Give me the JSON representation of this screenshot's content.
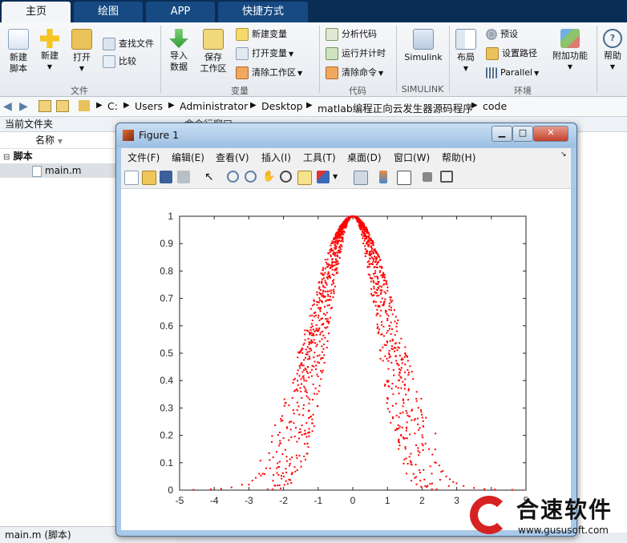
{
  "tabs": [
    "主页",
    "绘图",
    "APP",
    "快捷方式"
  ],
  "ribbon": {
    "file": {
      "new_script": "新建\n脚本",
      "new": "新建",
      "open": "打开",
      "find_files": "查找文件",
      "compare": "比较",
      "group": "文件"
    },
    "variable": {
      "import": "导入\n数据",
      "save_ws": "保存\n工作区",
      "new_var": "新建变量",
      "open_var": "打开变量",
      "clear_ws": "清除工作区",
      "group": "变量"
    },
    "code": {
      "analyze": "分析代码",
      "run_time": "运行并计时",
      "clear_cmd": "清除命令",
      "group": "代码"
    },
    "simulink": {
      "label": "Simulink",
      "group": "SIMULINK"
    },
    "env": {
      "layout": "布局",
      "prefs": "预设",
      "set_path": "设置路径",
      "parallel": "Parallel",
      "addons": "附加功能",
      "group": "环境"
    },
    "help": "帮助",
    "colors": {
      "accent_blue": "#0a2d56",
      "tab_blue": "#174a82"
    }
  },
  "address": {
    "crumbs": [
      "C:",
      "Users",
      "Administrator",
      "Desktop",
      "matlab编程正向云发生器源码程序",
      "code"
    ]
  },
  "left_panel": {
    "title": "当前文件夹",
    "col_name": "名称",
    "group": "脚本",
    "file": "main.m"
  },
  "status": {
    "file": "main.m",
    "type": "(脚本)"
  },
  "cmd_window": {
    "title": "命令行窗口"
  },
  "figure": {
    "title": "Figure 1",
    "menu": [
      "文件(F)",
      "编辑(E)",
      "查看(V)",
      "插入(I)",
      "工具(T)",
      "桌面(D)",
      "窗口(W)",
      "帮助(H)"
    ],
    "toolbar_icons": [
      "new-figure-icon",
      "open-icon",
      "save-icon",
      "print-icon",
      "pointer-icon",
      "zoom-in-icon",
      "zoom-out-icon",
      "pan-icon",
      "rotate-icon",
      "data-cursor-icon",
      "brush-icon",
      "link-icon",
      "colorbar-icon",
      "legend-icon",
      "hide-tools-icon",
      "show-tools-icon"
    ]
  },
  "chart_data": {
    "type": "scatter",
    "title": "",
    "xlabel": "",
    "ylabel": "",
    "xlim": [
      -5,
      5
    ],
    "ylim": [
      0,
      1
    ],
    "xticks": [
      -5,
      -4,
      -3,
      -2,
      -1,
      0,
      1,
      2,
      3,
      4,
      5
    ],
    "yticks": [
      0,
      0.1,
      0.2,
      0.3,
      0.4,
      0.5,
      0.6,
      0.7,
      0.8,
      0.9,
      1
    ],
    "grid": false,
    "marker_color": "#ff0000",
    "series": [
      {
        "values_description_only": "cloud drops",
        "points": [
          [
            0,
            1
          ],
          [
            0.05,
            0.998
          ],
          [
            -0.05,
            0.997
          ],
          [
            0.1,
            0.99
          ],
          [
            -0.1,
            0.99
          ],
          [
            0.15,
            0.985
          ],
          [
            -0.15,
            0.98
          ],
          [
            0.2,
            0.975
          ],
          [
            -0.2,
            0.97
          ],
          [
            0.25,
            0.96
          ],
          [
            -0.25,
            0.96
          ],
          [
            0.3,
            0.95
          ],
          [
            -0.3,
            0.94
          ],
          [
            0.35,
            0.93
          ],
          [
            -0.35,
            0.93
          ],
          [
            0.4,
            0.92
          ],
          [
            -0.4,
            0.91
          ],
          [
            0.45,
            0.89
          ],
          [
            -0.45,
            0.9
          ],
          [
            0.5,
            0.87
          ],
          [
            -0.5,
            0.88
          ],
          [
            0.55,
            0.85
          ],
          [
            -0.55,
            0.86
          ],
          [
            0.6,
            0.84
          ],
          [
            -0.6,
            0.83
          ],
          [
            0.65,
            0.8
          ],
          [
            -0.65,
            0.81
          ],
          [
            0.7,
            0.78
          ],
          [
            -0.7,
            0.79
          ],
          [
            0.75,
            0.76
          ],
          [
            -0.75,
            0.75
          ],
          [
            0.8,
            0.73
          ],
          [
            -0.8,
            0.74
          ],
          [
            0.85,
            0.7
          ],
          [
            -0.85,
            0.71
          ],
          [
            0.9,
            0.68
          ],
          [
            -0.9,
            0.69
          ],
          [
            0.95,
            0.65
          ],
          [
            -0.95,
            0.66
          ],
          [
            1.0,
            0.62
          ],
          [
            -1.0,
            0.63
          ],
          [
            1.05,
            0.6
          ],
          [
            -1.05,
            0.59
          ],
          [
            1.1,
            0.57
          ],
          [
            -1.1,
            0.58
          ],
          [
            1.15,
            0.55
          ],
          [
            -1.15,
            0.54
          ],
          [
            1.2,
            0.52
          ],
          [
            -1.2,
            0.51
          ],
          [
            1.25,
            0.49
          ],
          [
            -1.25,
            0.48
          ],
          [
            1.3,
            0.46
          ],
          [
            -1.3,
            0.45
          ],
          [
            1.35,
            0.43
          ],
          [
            -1.35,
            0.44
          ],
          [
            1.4,
            0.41
          ],
          [
            -1.4,
            0.4
          ],
          [
            1.5,
            0.37
          ],
          [
            -1.5,
            0.36
          ],
          [
            1.6,
            0.33
          ],
          [
            -1.6,
            0.32
          ],
          [
            1.7,
            0.29
          ],
          [
            -1.7,
            0.28
          ],
          [
            1.8,
            0.26
          ],
          [
            -1.8,
            0.25
          ],
          [
            1.9,
            0.22
          ],
          [
            -1.9,
            0.23
          ],
          [
            2.0,
            0.2
          ],
          [
            -2.0,
            0.19
          ],
          [
            2.1,
            0.17
          ],
          [
            -2.1,
            0.18
          ],
          [
            2.2,
            0.15
          ],
          [
            -2.2,
            0.14
          ],
          [
            2.3,
            0.13
          ],
          [
            -2.3,
            0.12
          ],
          [
            2.4,
            0.1
          ],
          [
            -2.4,
            0.11
          ],
          [
            2.5,
            0.09
          ],
          [
            -2.5,
            0.08
          ],
          [
            2.6,
            0.07
          ],
          [
            -2.6,
            0.06
          ],
          [
            2.7,
            0.05
          ],
          [
            -2.7,
            0.06
          ],
          [
            2.8,
            0.04
          ],
          [
            -2.8,
            0.045
          ],
          [
            2.9,
            0.03
          ],
          [
            -2.9,
            0.035
          ],
          [
            3.0,
            0.025
          ],
          [
            -3.0,
            0.02
          ],
          [
            3.2,
            0.015
          ],
          [
            -3.2,
            0.02
          ],
          [
            3.5,
            0.008
          ],
          [
            -3.5,
            0.01
          ],
          [
            3.8,
            0.004
          ],
          [
            -3.8,
            0.005
          ],
          [
            4.1,
            0.002
          ],
          [
            -4.1,
            0.003
          ],
          [
            4.6,
            0.001
          ],
          [
            -4.6,
            0.001
          ]
        ]
      }
    ]
  },
  "watermark": {
    "brand": "合速软件",
    "url": "www.gususoft.com"
  }
}
